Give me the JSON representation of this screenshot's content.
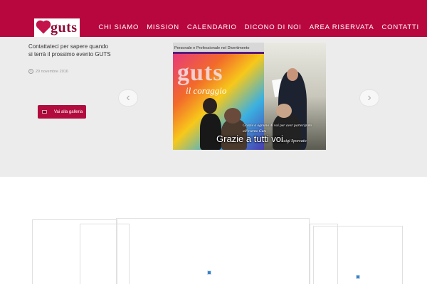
{
  "header": {
    "logo_text": "guts",
    "nav": [
      {
        "label": "CHI SIAMO"
      },
      {
        "label": "MISSION"
      },
      {
        "label": "CALENDARIO"
      },
      {
        "label": "DICONO DI NOI"
      },
      {
        "label": "AREA RISERVATA"
      },
      {
        "label": "CONTATTI"
      }
    ],
    "colors": {
      "brand": "#b8063f",
      "logo_text": "#8f0b37"
    }
  },
  "hero": {
    "text": "Contattateci per sapere quando si terrà il prossimo evento GUTS",
    "date": "29 novembre 2016",
    "gallery_button": "Vai alla galleria",
    "arrow_left": "‹",
    "arrow_right": "›",
    "background": "#ececec",
    "slide": {
      "banner": "Personale e Professionale nel Divertimento",
      "poster_word": "guts",
      "poster_sub": "il coraggio",
      "overlay_text": "Grazie a ognuno di voi per aver partecipato all'evento Guts",
      "signature": "Luigi Sporcato",
      "caption": "Grazie a tutti voi"
    }
  },
  "icons": [
    "heart-icon",
    "clock-icon",
    "gallery-icon",
    "chevron-left-icon",
    "chevron-right-icon",
    "broken-image-icon"
  ]
}
